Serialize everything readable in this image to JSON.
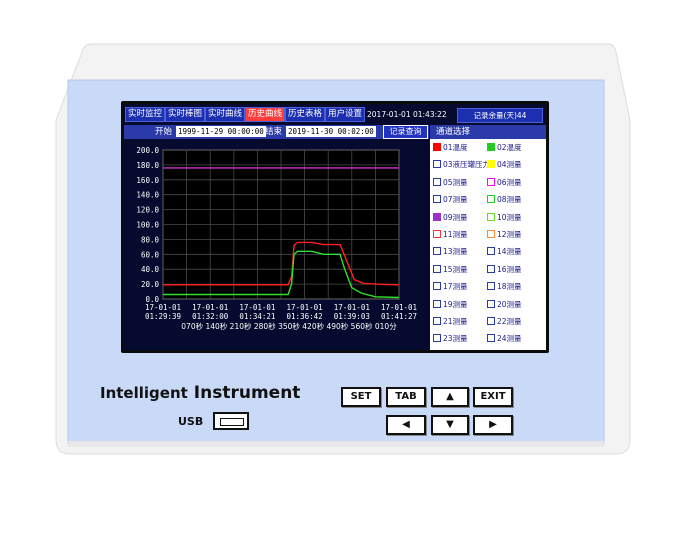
{
  "tabs": [
    {
      "label": "实时监控",
      "active": false
    },
    {
      "label": "实时棒图",
      "active": false
    },
    {
      "label": "实时曲线",
      "active": false
    },
    {
      "label": "历史曲线",
      "active": true
    },
    {
      "label": "历史表格",
      "active": false
    },
    {
      "label": "用户设置",
      "active": false
    }
  ],
  "clock": "2017-01-01 01:43:22",
  "remaining": "记录余量(天)44",
  "range": {
    "start_label": "开始",
    "start_value": "1999-11-29 00:00:00",
    "end_label": "结束",
    "end_value": "2019-11-30 00:02:00",
    "query_button": "记录查询"
  },
  "channel_panel": {
    "title": "通道选择",
    "channels": [
      {
        "label": "01温度",
        "color": "#ff0000",
        "filled": true
      },
      {
        "label": "02温度",
        "color": "#22cc22",
        "filled": true
      },
      {
        "label": "03液压罐压力",
        "color": "#ffffff",
        "filled": false
      },
      {
        "label": "04测量",
        "color": "#ffff00",
        "filled": true
      },
      {
        "label": "05测量",
        "color": "#ffffff",
        "filled": false
      },
      {
        "label": "06测量",
        "color": "#ff00ff",
        "filled": false
      },
      {
        "label": "07测量",
        "color": "#ffffff",
        "filled": false
      },
      {
        "label": "08测量",
        "color": "#22cc22",
        "filled": false
      },
      {
        "label": "09测量",
        "color": "#9933cc",
        "filled": true
      },
      {
        "label": "10测量",
        "color": "#66dd22",
        "filled": false
      },
      {
        "label": "11测量",
        "color": "#ff3333",
        "filled": false
      },
      {
        "label": "12测量",
        "color": "#ff8833",
        "filled": false
      },
      {
        "label": "13测量",
        "color": "#ffffff",
        "filled": false
      },
      {
        "label": "14测量",
        "color": "#ffffff",
        "filled": false
      },
      {
        "label": "15测量",
        "color": "#ffffff",
        "filled": false
      },
      {
        "label": "16测量",
        "color": "#ffffff",
        "filled": false
      },
      {
        "label": "17测量",
        "color": "#ffffff",
        "filled": false
      },
      {
        "label": "18测量",
        "color": "#ffffff",
        "filled": false
      },
      {
        "label": "19测量",
        "color": "#ffffff",
        "filled": false
      },
      {
        "label": "20测量",
        "color": "#ffffff",
        "filled": false
      },
      {
        "label": "21测量",
        "color": "#ffffff",
        "filled": false
      },
      {
        "label": "22测量",
        "color": "#ffffff",
        "filled": false
      },
      {
        "label": "23测量",
        "color": "#ffffff",
        "filled": false
      },
      {
        "label": "24测量",
        "color": "#ffffff",
        "filled": false
      }
    ]
  },
  "chart_data": {
    "type": "line",
    "ylim": [
      0,
      200
    ],
    "y_ticks": [
      "200.0",
      "180.0",
      "160.0",
      "140.0",
      "120.0",
      "100.0",
      "80.0",
      "60.0",
      "40.0",
      "20.0",
      "0.0"
    ],
    "x_ticks": [
      {
        "date": "17-01-01",
        "time": "01:29:39"
      },
      {
        "date": "17-01-01",
        "time": "01:32:00"
      },
      {
        "date": "17-01-01",
        "time": "01:34:21"
      },
      {
        "date": "17-01-01",
        "time": "01:36:42"
      },
      {
        "date": "17-01-01",
        "time": "01:39:03"
      },
      {
        "date": "17-01-01",
        "time": "01:41:27"
      }
    ],
    "x_duration_labels": "070秒 140秒 210秒 280秒 350秒 420秒 490秒 560秒 010分",
    "grid": true,
    "x_range": [
      0,
      10
    ],
    "series": [
      {
        "name": "01温度",
        "color": "#ff2020",
        "points": [
          [
            0,
            19
          ],
          [
            5.3,
            19
          ],
          [
            5.45,
            30
          ],
          [
            5.55,
            72
          ],
          [
            5.7,
            76
          ],
          [
            6.3,
            76
          ],
          [
            6.8,
            73
          ],
          [
            7.5,
            73
          ],
          [
            7.7,
            58
          ],
          [
            8.1,
            26
          ],
          [
            8.5,
            21
          ],
          [
            9.0,
            20
          ],
          [
            10,
            19
          ]
        ]
      },
      {
        "name": "02温度",
        "color": "#2ee02e",
        "points": [
          [
            0,
            6
          ],
          [
            5.3,
            6
          ],
          [
            5.45,
            20
          ],
          [
            5.55,
            60
          ],
          [
            5.7,
            64
          ],
          [
            6.3,
            64
          ],
          [
            6.8,
            60
          ],
          [
            7.5,
            60
          ],
          [
            7.7,
            40
          ],
          [
            8.0,
            15
          ],
          [
            8.4,
            8
          ],
          [
            9.0,
            3
          ],
          [
            10,
            2
          ]
        ]
      },
      {
        "name": "",
        "color": "#cc33cc",
        "points": [
          [
            0,
            176
          ],
          [
            10,
            176
          ]
        ]
      }
    ]
  },
  "keypad": {
    "brand_line1": "Intelligent",
    "brand_line2": "Instrument",
    "usb_label": "USB",
    "set": "SET",
    "tab": "TAB",
    "up": "▲",
    "exit": "EXIT",
    "left": "◀",
    "down": "▼",
    "right": "▶"
  },
  "colors": {
    "device_face": "#c9daf8",
    "screen_bg": "#050a2e",
    "tab_bg": "#1b2fb0",
    "tab_active": "#ff3c3c"
  }
}
